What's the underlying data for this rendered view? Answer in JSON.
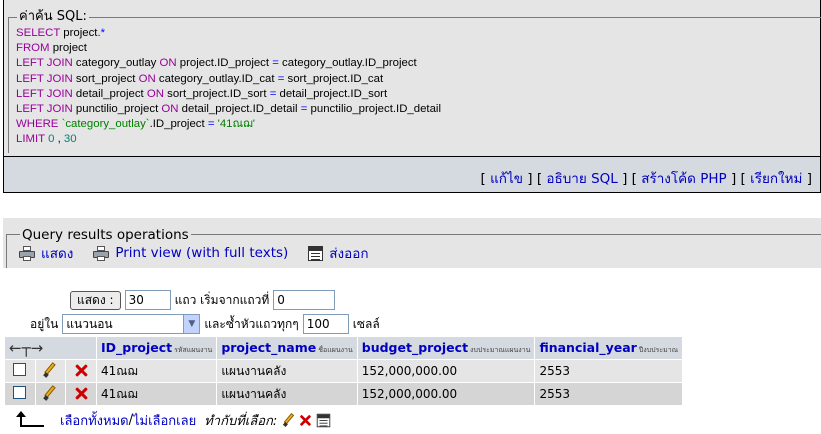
{
  "sql_box": {
    "legend": "ค่าค้น SQL:",
    "lines": [
      [
        {
          "t": "SELECT",
          "c": "kw"
        },
        {
          "t": " project",
          "c": ""
        },
        {
          "t": ".",
          "c": "op"
        },
        {
          "t": "*",
          "c": "op"
        }
      ],
      [
        {
          "t": "FROM",
          "c": "kw"
        },
        {
          "t": " project",
          "c": ""
        }
      ],
      [
        {
          "t": "LEFT JOIN",
          "c": "kw"
        },
        {
          "t": " category_outlay ",
          "c": ""
        },
        {
          "t": "ON",
          "c": "kw"
        },
        {
          "t": " project.ID_project ",
          "c": ""
        },
        {
          "t": "=",
          "c": "op"
        },
        {
          "t": " category_outlay.ID_project",
          "c": ""
        }
      ],
      [
        {
          "t": "LEFT JOIN",
          "c": "kw"
        },
        {
          "t": " sort_project ",
          "c": ""
        },
        {
          "t": "ON",
          "c": "kw"
        },
        {
          "t": " category_outlay.ID_cat ",
          "c": ""
        },
        {
          "t": "=",
          "c": "op"
        },
        {
          "t": " sort_project.ID_cat",
          "c": ""
        }
      ],
      [
        {
          "t": "LEFT JOIN",
          "c": "kw"
        },
        {
          "t": " detail_project ",
          "c": ""
        },
        {
          "t": "ON",
          "c": "kw"
        },
        {
          "t": " sort_project.ID_sort ",
          "c": ""
        },
        {
          "t": "=",
          "c": "op"
        },
        {
          "t": " detail_project.ID_sort",
          "c": ""
        }
      ],
      [
        {
          "t": "LEFT JOIN",
          "c": "kw"
        },
        {
          "t": " punctilio_project ",
          "c": ""
        },
        {
          "t": "ON",
          "c": "kw"
        },
        {
          "t": " detail_project.ID_detail ",
          "c": ""
        },
        {
          "t": "=",
          "c": "op"
        },
        {
          "t": " punctilio_project.ID_detail",
          "c": ""
        }
      ],
      [
        {
          "t": "WHERE",
          "c": "kw"
        },
        {
          "t": " `category_outlay`",
          "c": "str"
        },
        {
          "t": ".ID_project ",
          "c": ""
        },
        {
          "t": "=",
          "c": "op"
        },
        {
          "t": " '41ณฌ'",
          "c": "str"
        }
      ],
      [
        {
          "t": "LIMIT",
          "c": "kw"
        },
        {
          "t": " 0",
          "c": "num"
        },
        {
          "t": " , ",
          "c": ""
        },
        {
          "t": "30",
          "c": "num"
        }
      ]
    ]
  },
  "links": {
    "edit": "แก้ไข",
    "explain": "อธิบาย SQL",
    "create_php": "สร้างโค้ด PHP",
    "refresh": "เรียกใหม่"
  },
  "ops": {
    "legend": "Query results operations",
    "print": "แสดง",
    "print_view": "Print view (with full texts)",
    "export": "ส่งออก"
  },
  "nav": {
    "show_button": "แสดง :",
    "rows_value": "30",
    "rows_label": "แถว เริ่มจากแถวที่",
    "start_value": "0",
    "in_label": "อยู่ใน",
    "mode_value": "แนวนอน",
    "repeat_label": "และซ้ำหัวแถวทุกๆ",
    "repeat_value": "100",
    "cells_label": "เซลล์"
  },
  "table": {
    "columns": [
      {
        "name": "ID_project",
        "comment": "รหัสแผนงาน"
      },
      {
        "name": "project_name",
        "comment": "ชื่อแผนงาน"
      },
      {
        "name": "budget_project",
        "comment": "งบประมาณแผนงาน"
      },
      {
        "name": "financial_year",
        "comment": "ปีงบประมาณ"
      }
    ],
    "rows": [
      [
        "41ณฌ",
        "แผนงานคลัง",
        "152,000,000.00",
        "2553"
      ],
      [
        "41ณฌ",
        "แผนงานคลัง",
        "152,000,000.00",
        "2553"
      ]
    ]
  },
  "bottom": {
    "check_all": "เลือกทั้งหมด",
    "separator": " / ",
    "uncheck_all": "ไม่เลือกเลย",
    "with_selected": "ทำกับที่เลือก:"
  },
  "colors": {
    "keyword": "#990099",
    "operator": "#0000ff",
    "string": "#008000",
    "number": "#008080",
    "link": "#0000c0",
    "delete": "#cc0000"
  }
}
